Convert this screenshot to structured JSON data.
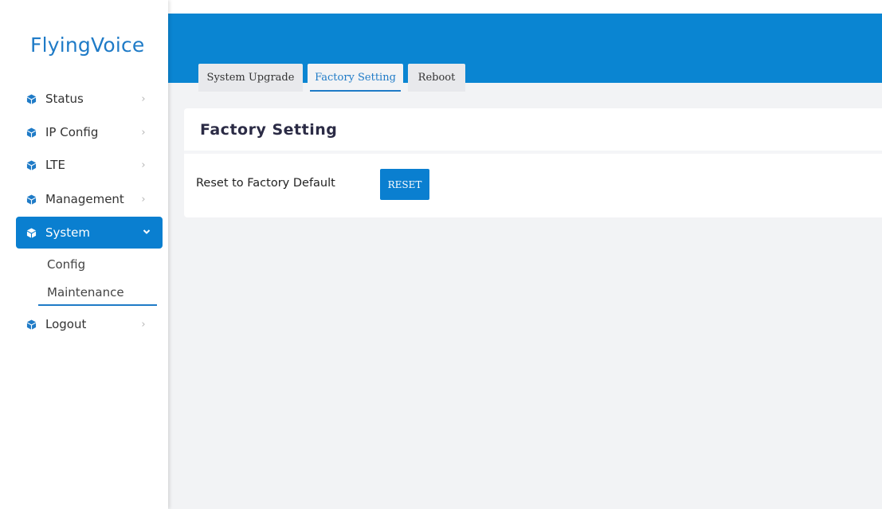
{
  "app": {
    "logo": "FlyingVoice"
  },
  "sidebar": {
    "items": [
      {
        "label": "Status",
        "icon": "cube-icon",
        "expanded": false
      },
      {
        "label": "IP Config",
        "icon": "cube-icon",
        "expanded": false
      },
      {
        "label": "LTE",
        "icon": "cube-icon",
        "expanded": false
      },
      {
        "label": "Management",
        "icon": "cube-icon",
        "expanded": false
      },
      {
        "label": "System",
        "icon": "cube-icon",
        "expanded": true
      },
      {
        "label": "Logout",
        "icon": "cube-icon",
        "expanded": false
      }
    ],
    "system_sub": [
      {
        "label": "Config"
      },
      {
        "label": "Maintenance",
        "selected": true
      }
    ]
  },
  "tabs": [
    {
      "label": "System Upgrade"
    },
    {
      "label": "Factory Setting",
      "selected": true
    },
    {
      "label": "Reboot"
    }
  ],
  "panel": {
    "title": "Factory Setting",
    "reset_label": "Reset to Factory Default",
    "reset_button": "RESET"
  },
  "colors": {
    "accent": "#0a7fd0",
    "header": "#0a85d2",
    "logo": "#1f7bc7",
    "background": "#f2f3f5"
  }
}
